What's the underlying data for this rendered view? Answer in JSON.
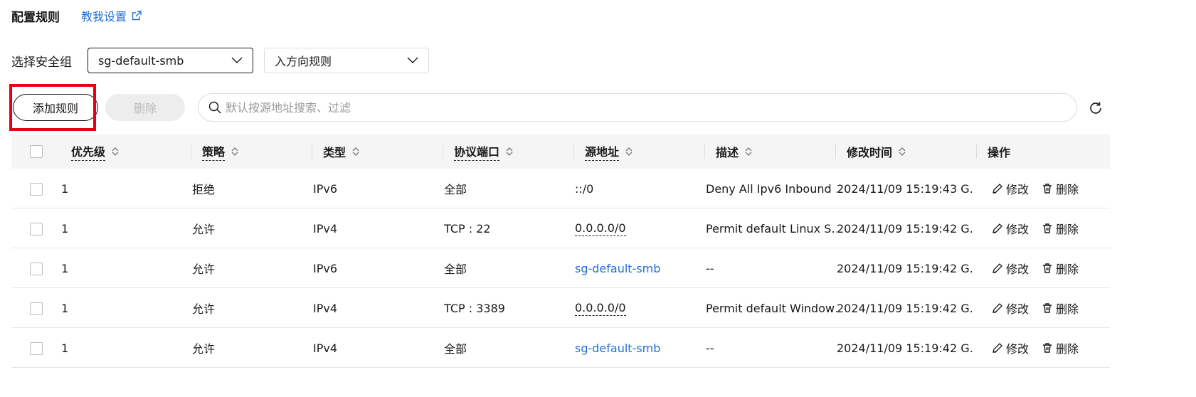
{
  "header": {
    "title": "配置规则",
    "help_link": "教我设置"
  },
  "selector": {
    "label": "选择安全组",
    "security_group": "sg-default-smb",
    "direction": "入方向规则"
  },
  "toolbar": {
    "add_label": "添加规则",
    "delete_label": "删除",
    "search_placeholder": "默认按源地址搜索、过滤"
  },
  "table": {
    "columns": [
      "优先级",
      "策略",
      "类型",
      "协议端口",
      "源地址",
      "描述",
      "修改时间",
      "操作"
    ],
    "rows": [
      {
        "priority": "1",
        "policy": "拒绝",
        "type": "IPv6",
        "port": "全部",
        "source": "::/0",
        "source_style": "plain",
        "description": "Deny All Ipv6 Inbound …",
        "time": "2024/11/09 15:19:43 G…",
        "edit": "修改",
        "delete": "删除"
      },
      {
        "priority": "1",
        "policy": "允许",
        "type": "IPv4",
        "port": "TCP : 22",
        "source": "0.0.0.0/0",
        "source_style": "dashed",
        "description": "Permit default Linux S…",
        "time": "2024/11/09 15:19:42 G…",
        "edit": "修改",
        "delete": "删除"
      },
      {
        "priority": "1",
        "policy": "允许",
        "type": "IPv6",
        "port": "全部",
        "source": "sg-default-smb",
        "source_style": "link",
        "description": "--",
        "time": "2024/11/09 15:19:42 G…",
        "edit": "修改",
        "delete": "删除"
      },
      {
        "priority": "1",
        "policy": "允许",
        "type": "IPv4",
        "port": "TCP : 3389",
        "source": "0.0.0.0/0",
        "source_style": "dashed",
        "description": "Permit default Window…",
        "time": "2024/11/09 15:19:42 G…",
        "edit": "修改",
        "delete": "删除"
      },
      {
        "priority": "1",
        "policy": "允许",
        "type": "IPv4",
        "port": "全部",
        "source": "sg-default-smb",
        "source_style": "link",
        "description": "--",
        "time": "2024/11/09 15:19:42 G…",
        "edit": "修改",
        "delete": "删除"
      }
    ]
  },
  "colors": {
    "link": "#1f6fd6",
    "highlight": "#e60012",
    "header_bg": "#f5f5f5"
  }
}
